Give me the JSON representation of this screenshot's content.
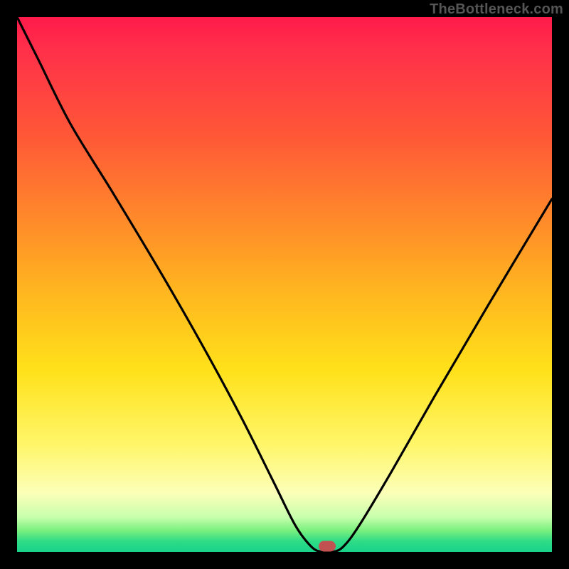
{
  "watermark": "TheBottleneck.com",
  "colors": {
    "frame": "#000000",
    "marker": "#c25252",
    "curve": "#000000",
    "gradient_stops": [
      {
        "pos": 0.0,
        "hex": "#ff1a4b"
      },
      {
        "pos": 0.06,
        "hex": "#ff2f4a"
      },
      {
        "pos": 0.22,
        "hex": "#ff5737"
      },
      {
        "pos": 0.38,
        "hex": "#ff8a2a"
      },
      {
        "pos": 0.52,
        "hex": "#ffb81f"
      },
      {
        "pos": 0.66,
        "hex": "#ffe11a"
      },
      {
        "pos": 0.8,
        "hex": "#fff66a"
      },
      {
        "pos": 0.89,
        "hex": "#fcffb8"
      },
      {
        "pos": 0.935,
        "hex": "#c7ffad"
      },
      {
        "pos": 0.96,
        "hex": "#7af07e"
      },
      {
        "pos": 0.98,
        "hex": "#2fdc86"
      },
      {
        "pos": 1.0,
        "hex": "#19d18a"
      }
    ]
  },
  "chart_data": {
    "type": "line",
    "title": "",
    "xlabel": "",
    "ylabel": "",
    "xlim": [
      0,
      100
    ],
    "ylim": [
      0,
      100
    ],
    "series": [
      {
        "name": "bottleneck-curve",
        "x": [
          0,
          4,
          10,
          18,
          27,
          35,
          42,
          48,
          52,
          55,
          57,
          59,
          61,
          64,
          70,
          78,
          88,
          100
        ],
        "y": [
          100,
          92,
          80,
          67,
          52,
          38,
          25,
          13,
          5,
          1,
          0,
          0,
          1,
          5,
          15,
          29,
          46,
          66
        ]
      }
    ],
    "annotations": [
      {
        "name": "optimal-marker",
        "x": 58,
        "y": 0
      }
    ]
  },
  "marker": {
    "x_pct": 58,
    "y_pct": 99
  }
}
